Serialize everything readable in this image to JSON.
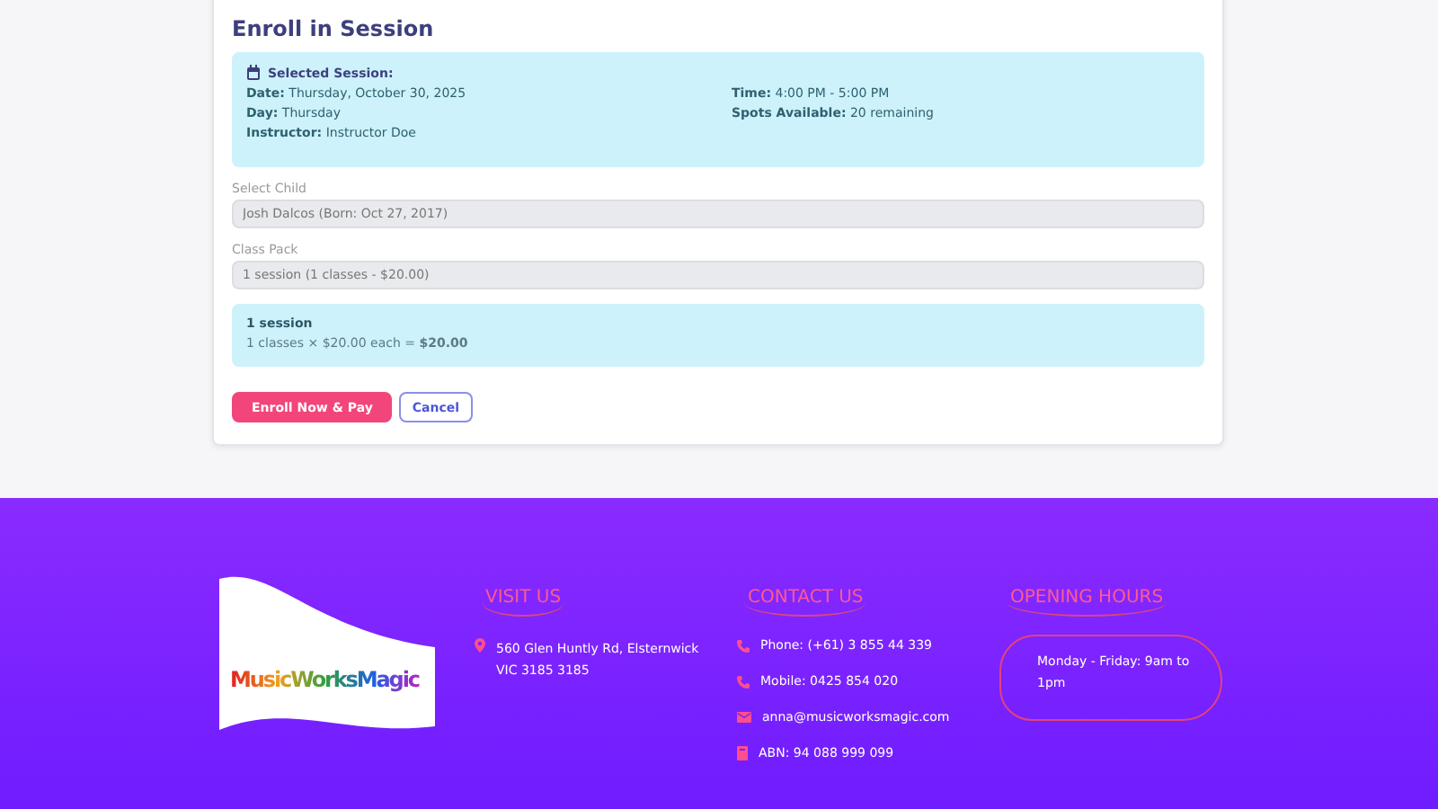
{
  "enroll": {
    "title": "Enroll in Session",
    "session": {
      "heading": "Selected Session:",
      "details": [
        {
          "label": "Date:",
          "value": "Thursday, October 30, 2025"
        },
        {
          "label": "Time:",
          "value": "4:00 PM - 5:00 PM"
        },
        {
          "label": "Day:",
          "value": "Thursday"
        },
        {
          "label": "Spots Available:",
          "value": "20 remaining"
        },
        {
          "label": "Instructor:",
          "value": "Instructor Doe"
        }
      ]
    },
    "fields": [
      {
        "label": "Select Child",
        "value": "Josh Dalcos (Born: Oct 27, 2017)",
        "disabled": true
      },
      {
        "label": "Class Pack",
        "value": "1 session (1 classes - $20.00)",
        "disabled": true
      }
    ],
    "summary": {
      "title": "1 session",
      "text": "1 classes × $20.00 each = **$20.00**"
    },
    "buttons": [
      {
        "label": "Enroll Now & Pay",
        "kind": "primary"
      },
      {
        "label": "Cancel",
        "kind": "outline"
      }
    ]
  },
  "footer": {
    "logo": {
      "text": "MusicWorksMagic"
    },
    "visit": {
      "heading": "VISIT US",
      "address": "560 Glen Huntly Rd, Elsternwick VIC 3185 3185"
    },
    "contact": {
      "heading": "CONTACT US",
      "items": [
        {
          "kind": "phone",
          "text": "Phone: (+61) 3 855 44 339"
        },
        {
          "kind": "phone",
          "text": "Mobile: 0425 854 020"
        },
        {
          "kind": "email",
          "text": "anna@musicworksmagic.com"
        },
        {
          "kind": "book",
          "text": "ABN: 94 088 999 099"
        }
      ]
    },
    "hours": {
      "heading": "OPENING HOURS",
      "text": "Monday - Friday: 9am to 1pm"
    }
  }
}
